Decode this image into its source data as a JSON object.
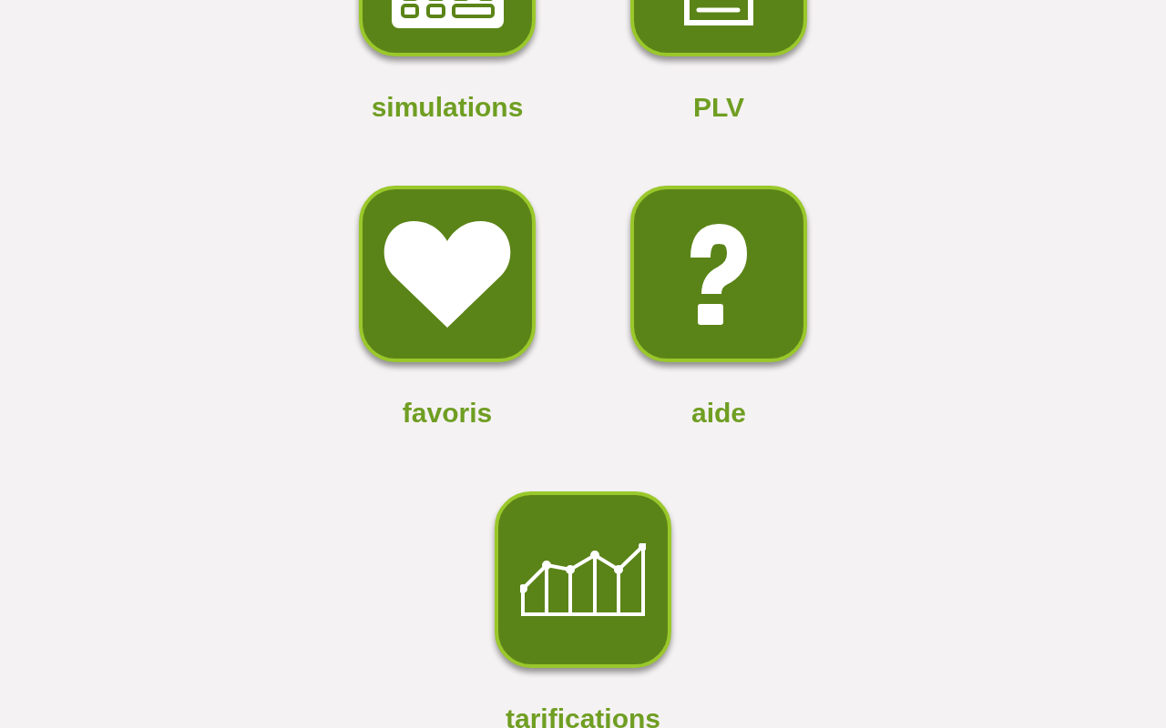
{
  "tiles": [
    {
      "label": "simulations",
      "kind": "calculator"
    },
    {
      "label": "PLV",
      "kind": "document"
    },
    {
      "label": "favoris",
      "kind": "heart"
    },
    {
      "label": "aide",
      "kind": "help"
    },
    {
      "label": "tarifications",
      "kind": "chart"
    }
  ]
}
